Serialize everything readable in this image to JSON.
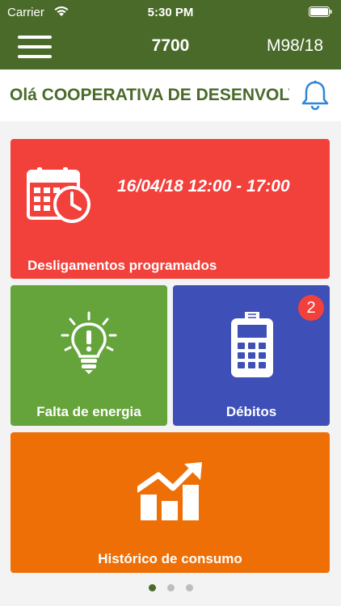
{
  "status_bar": {
    "carrier": "Carrier",
    "time": "5:30 PM"
  },
  "app_bar": {
    "title": "7700",
    "code": "M98/18"
  },
  "greeting": {
    "text": "Olá COOPERATIVA DE DESENVOLVIMENTO"
  },
  "tiles": {
    "outages": {
      "label": "Desligamentos programados",
      "schedule": "16/04/18 12:00 - 17:00",
      "icon": "calendar-clock-icon"
    },
    "power_failure": {
      "label": "Falta de energia",
      "icon": "lightbulb-alert-icon"
    },
    "debits": {
      "label": "Débitos",
      "badge": "2",
      "icon": "payment-terminal-icon"
    },
    "history": {
      "label": "Histórico de consumo",
      "icon": "chart-growth-icon"
    }
  },
  "pager": {
    "count": 3,
    "active_index": 0
  },
  "colors": {
    "brand_green": "#4a6a2a",
    "tile_red": "#f2403b",
    "tile_green": "#64a43b",
    "tile_blue": "#3e4fb8",
    "tile_orange": "#ee6f06"
  }
}
